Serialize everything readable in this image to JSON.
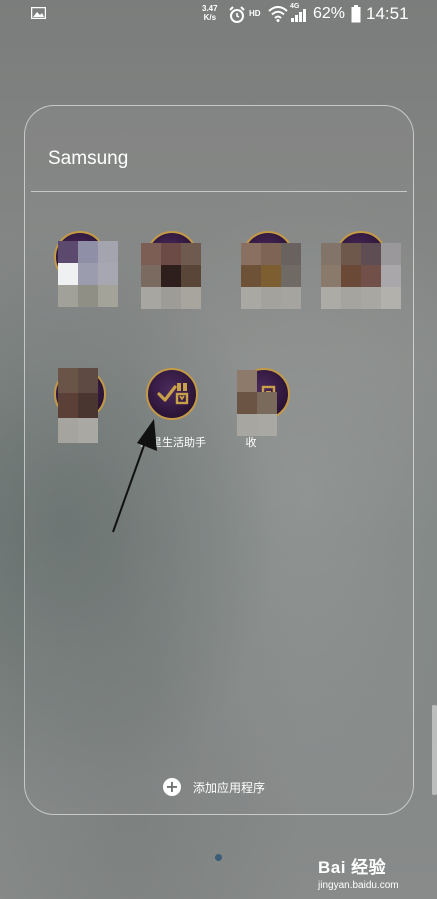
{
  "status_bar": {
    "speed_top": "3.47",
    "speed_bottom": "K/s",
    "hd": "HD",
    "network": "4G",
    "battery": "62%",
    "time": "14:51"
  },
  "folder": {
    "title": "Samsung",
    "apps_row1": [
      {
        "label": ""
      },
      {
        "label": ""
      },
      {
        "label": ""
      },
      {
        "label": ""
      }
    ],
    "apps_row2": [
      {
        "label": ""
      },
      {
        "label": "三星生活助手"
      },
      {
        "label": "收"
      }
    ],
    "add_apps_label": "添加应用程序"
  },
  "watermark": {
    "brand": "Bai 经验",
    "url": "jingyan.baidu.com"
  }
}
